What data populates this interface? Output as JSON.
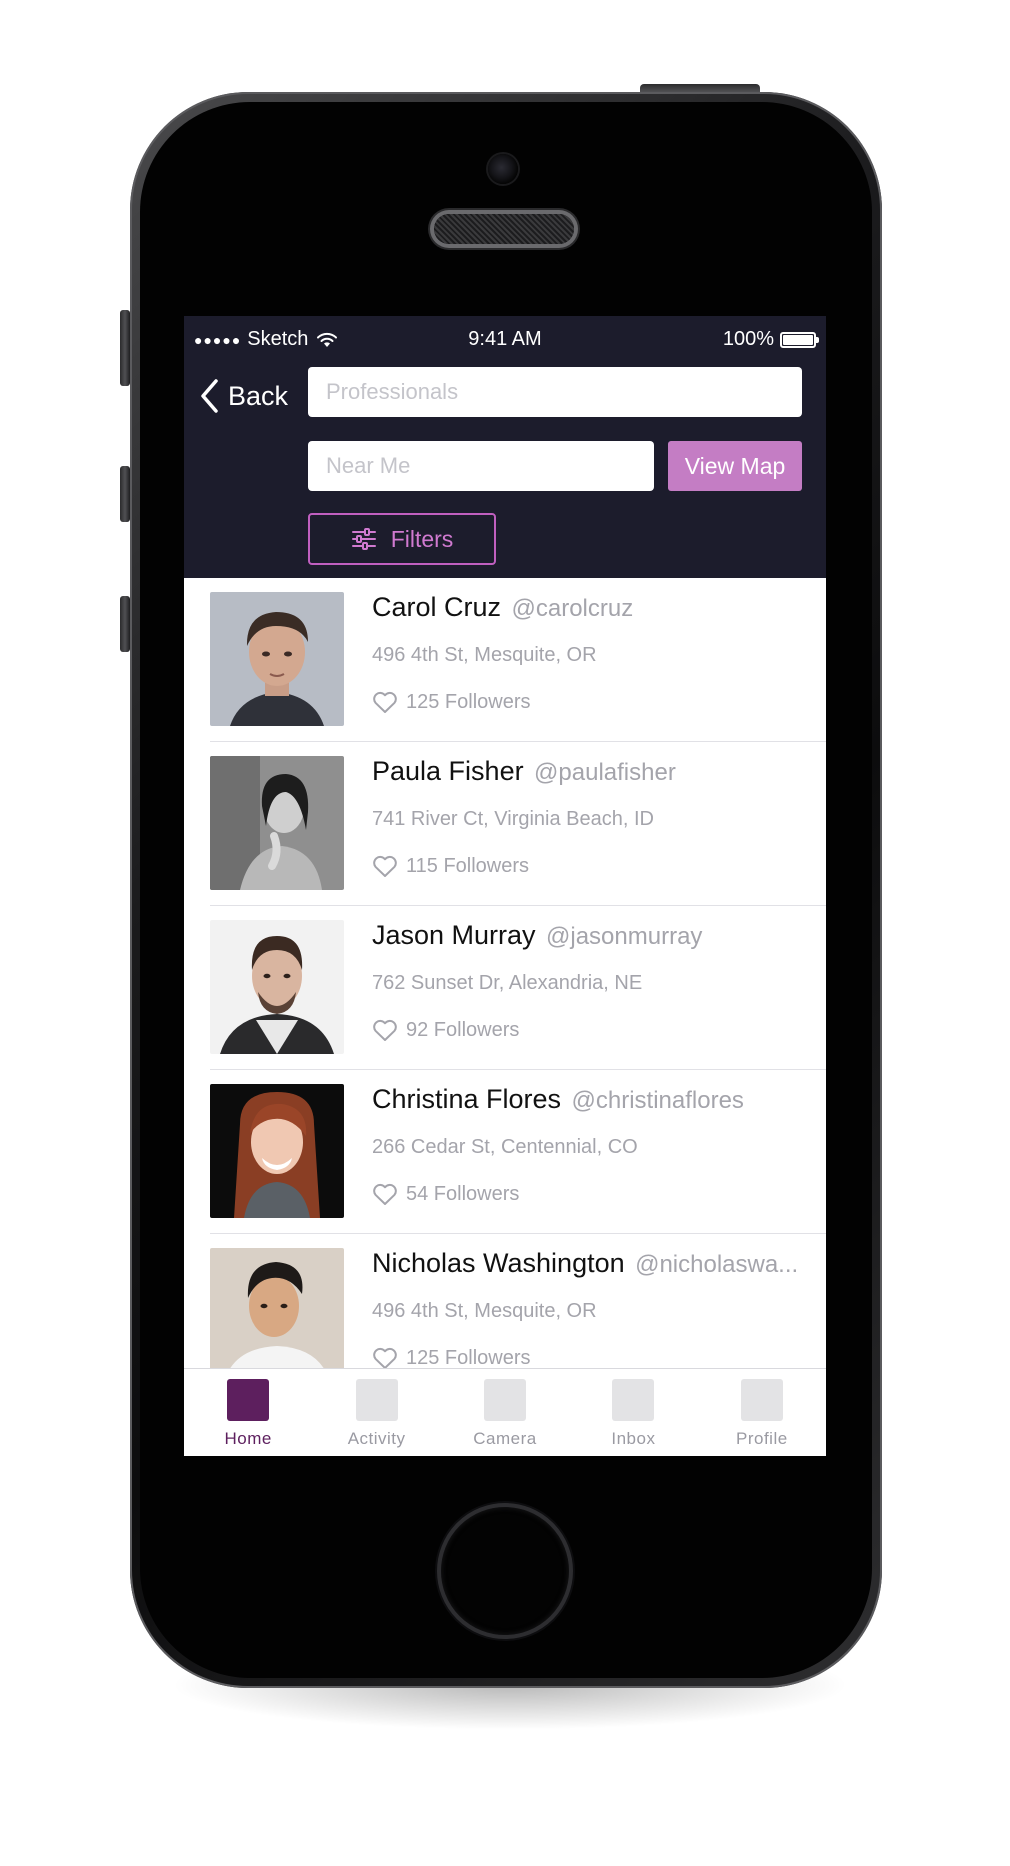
{
  "status_bar": {
    "signal": "●●●●●",
    "carrier": "Sketch",
    "time": "9:41 AM",
    "battery": "100%"
  },
  "header": {
    "back_label": "Back",
    "search_placeholder": "Professionals",
    "location_placeholder": "Near Me",
    "view_map_label": "View Map",
    "filters_label": "Filters"
  },
  "people": [
    {
      "name": "Carol Cruz",
      "handle": "@carolcruz",
      "address": "496 4th St, Mesquite, OR",
      "followers": "125 Followers"
    },
    {
      "name": "Paula Fisher",
      "handle": "@paulafisher",
      "address": "741 River Ct, Virginia Beach, ID",
      "followers": "115 Followers"
    },
    {
      "name": "Jason Murray",
      "handle": "@jasonmurray",
      "address": "762 Sunset Dr, Alexandria, NE",
      "followers": "92 Followers"
    },
    {
      "name": "Christina Flores",
      "handle": "@christinaflores",
      "address": "266 Cedar St, Centennial, CO",
      "followers": "54 Followers"
    },
    {
      "name": "Nicholas Washington",
      "handle": "@nicholaswa...",
      "address": "496 4th St, Mesquite, OR",
      "followers": "125 Followers"
    }
  ],
  "tabs": [
    {
      "label": "Home",
      "active": true
    },
    {
      "label": "Activity",
      "active": false
    },
    {
      "label": "Camera",
      "active": false
    },
    {
      "label": "Inbox",
      "active": false
    },
    {
      "label": "Profile",
      "active": false
    }
  ],
  "colors": {
    "header_bg": "#1c1c2c",
    "accent": "#c47dc4",
    "tab_active": "#5d1f5e"
  }
}
